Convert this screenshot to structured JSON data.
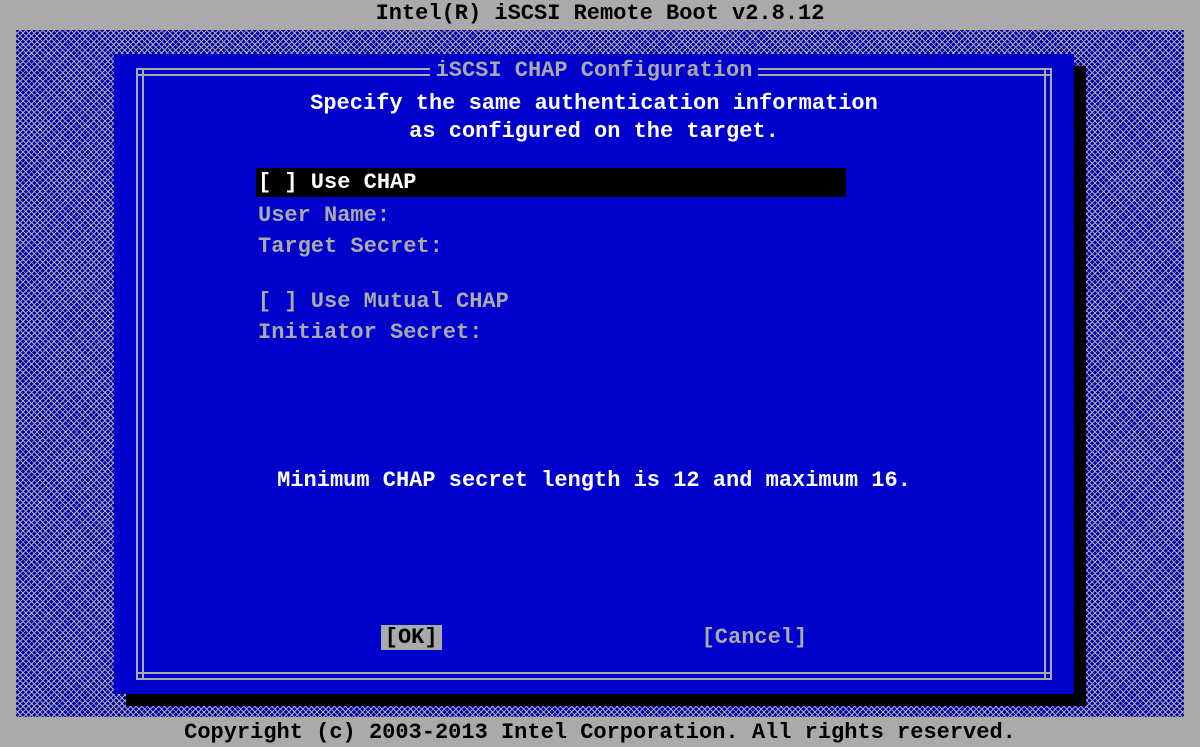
{
  "header": {
    "title": "Intel(R) iSCSI Remote Boot v2.8.12"
  },
  "footer": {
    "text": "Copyright (c) 2003-2013 Intel Corporation. All rights reserved."
  },
  "dialog": {
    "title": "iSCSI CHAP Configuration",
    "subtitle_line1": "Specify the same authentication information",
    "subtitle_line2": "as configured on the target.",
    "fields": {
      "use_chap": {
        "label": "[ ] Use CHAP",
        "checked": false
      },
      "user_name": {
        "label": "User Name:"
      },
      "target_secret": {
        "label": "Target Secret:"
      },
      "use_mutual_chap": {
        "label": "[ ] Use Mutual CHAP",
        "checked": false
      },
      "initiator_secret": {
        "label": "Initiator Secret:"
      }
    },
    "hint": "Minimum CHAP secret length is 12 and maximum 16.",
    "buttons": {
      "ok": "[OK]",
      "cancel": "[Cancel]"
    }
  }
}
